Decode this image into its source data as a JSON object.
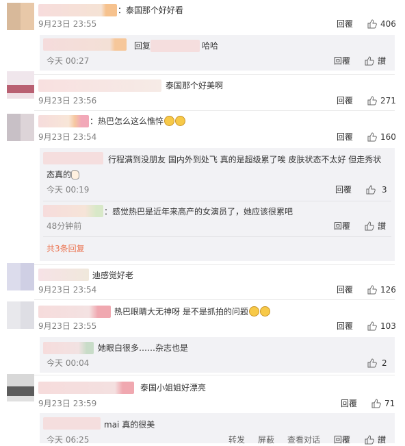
{
  "comments": [
    {
      "text": "：泰国那个好好看",
      "time": "9月23日 23:55",
      "reply": "回覆",
      "likes": "406"
    },
    {
      "text": "泰国那个好美啊",
      "time": "9月23日 23:56",
      "reply": "回覆",
      "likes": "271"
    },
    {
      "text": "：热巴怎么这么憔悴",
      "time": "9月23日 23:54",
      "reply": "回覆",
      "likes": "160"
    },
    {
      "text": "迪感觉好老",
      "time": "9月23日 23:54",
      "reply": "回覆",
      "likes": "126"
    },
    {
      "text": "热巴眼睛大无神呀 是不是抓拍的问题",
      "time": "9月23日 23:55",
      "reply": "回覆",
      "likes": "103"
    },
    {
      "text": "泰国小姐姐好漂亮",
      "time": "9月23日 23:59",
      "reply": "回覆",
      "likes": "71"
    }
  ],
  "sub_replies": [
    {
      "prefix": "回复",
      "suffix": "哈哈",
      "time": "今天 00:27",
      "reply": "回覆",
      "like_label": "讃"
    },
    {
      "line1": "行程满到没朋友 国内外到处飞 真的是超级累了唉 皮肤状态不太好 但走秀状",
      "line2": "态真的",
      "time": "今天 00:19",
      "reply": "回覆",
      "likes": "3"
    },
    {
      "text": "：感觉热巴是近年来高产的女演员了，她应该很累吧",
      "time": "48分钟前",
      "reply": "回覆",
      "like_label": "讃"
    },
    {
      "text": "她眼白很多……杂志也是",
      "time": "今天 00:04",
      "reply": "回覆",
      "likes": "2"
    },
    {
      "text": "mai 真的很美",
      "time": "今天 06:25",
      "reply": "回覆",
      "like_label": "讃"
    }
  ],
  "more_replies": "共3条回复",
  "bottom_partial": [
    "转发",
    "屏蔽",
    "查看对话"
  ]
}
